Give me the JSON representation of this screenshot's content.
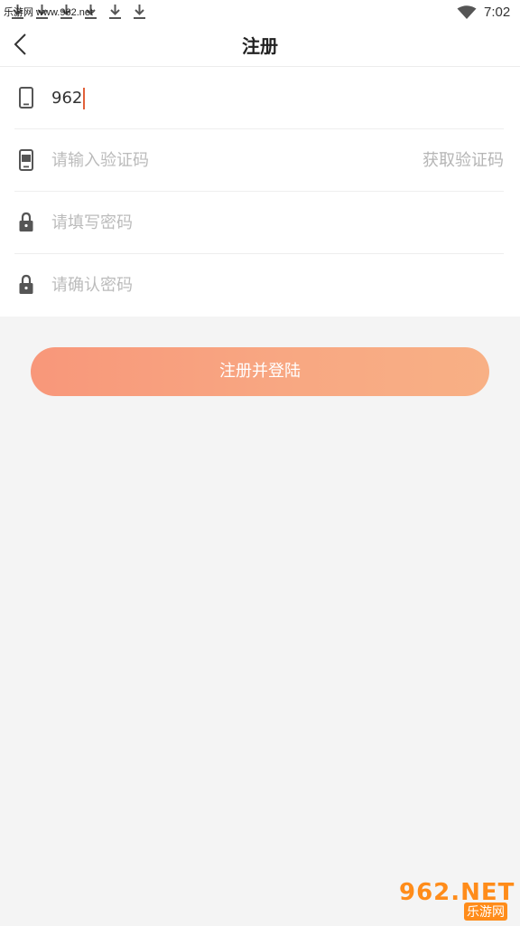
{
  "status_bar": {
    "source_text": "乐游网 www.962.net",
    "time": "7:02",
    "icons": [
      "download-icon",
      "download-icon",
      "download-icon",
      "download-icon",
      "download-icon",
      "download-icon",
      "wifi-icon"
    ]
  },
  "nav": {
    "title": "注册",
    "back_icon": "chevron-left-icon"
  },
  "form": {
    "phone": {
      "icon": "phone-icon",
      "value": "962"
    },
    "code": {
      "icon": "sms-code-icon",
      "placeholder": "请输入验证码",
      "action_label": "获取验证码"
    },
    "password": {
      "icon": "lock-icon",
      "placeholder": "请填写密码"
    },
    "confirm_password": {
      "icon": "lock-icon",
      "placeholder": "请确认密码"
    }
  },
  "submit": {
    "label": "注册并登陆"
  },
  "watermark": {
    "top": "962.NET",
    "bottom": "乐游网"
  },
  "colors": {
    "accent": "#f8977a",
    "accent_end": "#f8b085",
    "caret": "#e2613a",
    "background": "#f4f4f4",
    "placeholder": "#bbbbbb"
  }
}
